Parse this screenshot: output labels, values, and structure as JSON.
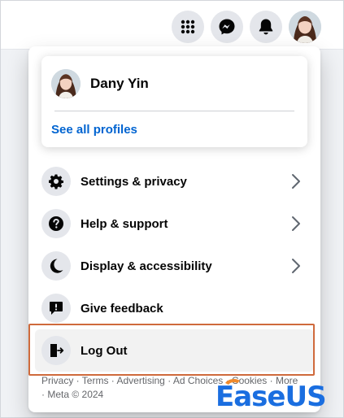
{
  "user": {
    "name": "Dany Yin"
  },
  "profile_card": {
    "see_all_label": "See all profiles"
  },
  "menu": [
    {
      "label": "Settings & privacy",
      "icon": "gear-icon",
      "has_chevron": true
    },
    {
      "label": "Help & support",
      "icon": "question-icon",
      "has_chevron": true
    },
    {
      "label": "Display & accessibility",
      "icon": "moon-icon",
      "has_chevron": true
    },
    {
      "label": "Give feedback",
      "icon": "feedback-icon",
      "has_chevron": false
    },
    {
      "label": "Log Out",
      "icon": "logout-icon",
      "has_chevron": false
    }
  ],
  "footer": {
    "links": [
      "Privacy",
      "Terms",
      "Advertising",
      "Ad Choices",
      "Cookies",
      "More"
    ],
    "separator": " · ",
    "copyright": "Meta © 2024"
  },
  "watermark": {
    "text": "EaseUS"
  },
  "colors": {
    "link_blue": "#0064d1",
    "icon_bg": "#e4e6eb",
    "highlight": "#cf6a3c",
    "watermark_blue": "#1a6ee0",
    "watermark_orange": "#f08a2c"
  }
}
